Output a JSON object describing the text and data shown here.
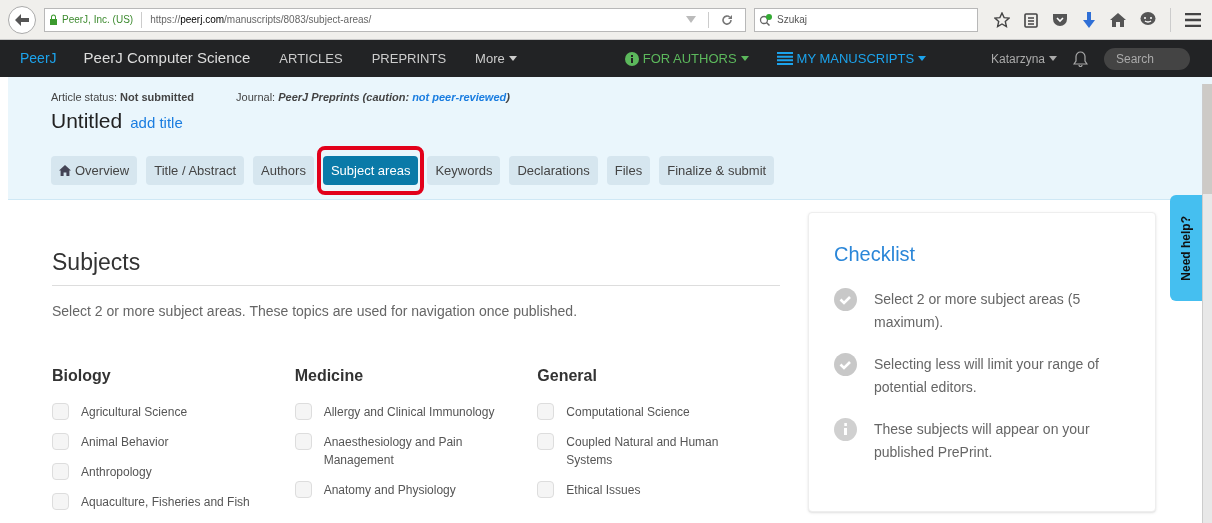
{
  "browser": {
    "site_identity": "PeerJ, Inc. (US)",
    "url_host_prefix": "https://",
    "url_host": "peerj.com",
    "url_path": "/manuscripts/8083/subject-areas/",
    "search": {
      "placeholder": "Szukaj"
    }
  },
  "navbar": {
    "logo": "PeerJ",
    "site": "PeerJ Computer Science",
    "links": [
      "ARTICLES",
      "PREPRINTS"
    ],
    "more": "More",
    "for_authors": "FOR AUTHORS",
    "my_manuscripts": "MY MANUSCRIPTS",
    "user": "Katarzyna",
    "search": {
      "placeholder": "Search"
    }
  },
  "header": {
    "status_label": "Article status:",
    "status": "Not submitted",
    "journal_label": "Journal:",
    "journal": "PeerJ Preprints (caution: ",
    "journal_link": "not peer-reviewed",
    "journal_end": ")",
    "title": "Untitled",
    "add_title": "add title"
  },
  "tabs": [
    {
      "label": "Overview",
      "selected": false,
      "highlighted": false,
      "kind": "home"
    },
    {
      "label": "Title / Abstract",
      "selected": false,
      "highlighted": false
    },
    {
      "label": "Authors",
      "selected": false,
      "highlighted": false
    },
    {
      "label": "Subject areas",
      "selected": true,
      "highlighted": true
    },
    {
      "label": "Keywords",
      "selected": false,
      "highlighted": false
    },
    {
      "label": "Declarations",
      "selected": false,
      "highlighted": false
    },
    {
      "label": "Files",
      "selected": false,
      "highlighted": false
    },
    {
      "label": "Finalize & submit",
      "selected": false,
      "highlighted": false
    }
  ],
  "subjects": {
    "title": "Subjects",
    "intro": "Select 2 or more subject areas. These topics are used for navigation once published.",
    "groups": [
      {
        "name": "Biology",
        "items": [
          {
            "label": "Agricultural Science",
            "checked": false
          },
          {
            "label": "Animal Behavior",
            "checked": false
          },
          {
            "label": "Anthropology",
            "checked": false
          },
          {
            "label": "Aquaculture, Fisheries and Fish",
            "checked": false
          }
        ]
      },
      {
        "name": "Medicine",
        "items": [
          {
            "label": "Allergy and Clinical Immunology",
            "checked": false
          },
          {
            "label": "Anaesthesiology and Pain Management",
            "checked": false
          },
          {
            "label": "Anatomy and Physiology",
            "checked": false
          }
        ]
      },
      {
        "name": "General",
        "items": [
          {
            "label": "Computational Science",
            "checked": false
          },
          {
            "label": "Coupled Natural and Human Systems",
            "checked": false
          },
          {
            "label": "Ethical Issues",
            "checked": false
          }
        ]
      }
    ]
  },
  "checklist": {
    "title": "Checklist",
    "items": [
      {
        "kind": "check",
        "text": "Select 2 or more subject areas (5 maximum)."
      },
      {
        "kind": "check",
        "text": "Selecting less will limit your range of potential editors."
      },
      {
        "kind": "info",
        "text": "These subjects will appear on your published PrePrint."
      }
    ]
  },
  "help_tab": "Need help?"
}
